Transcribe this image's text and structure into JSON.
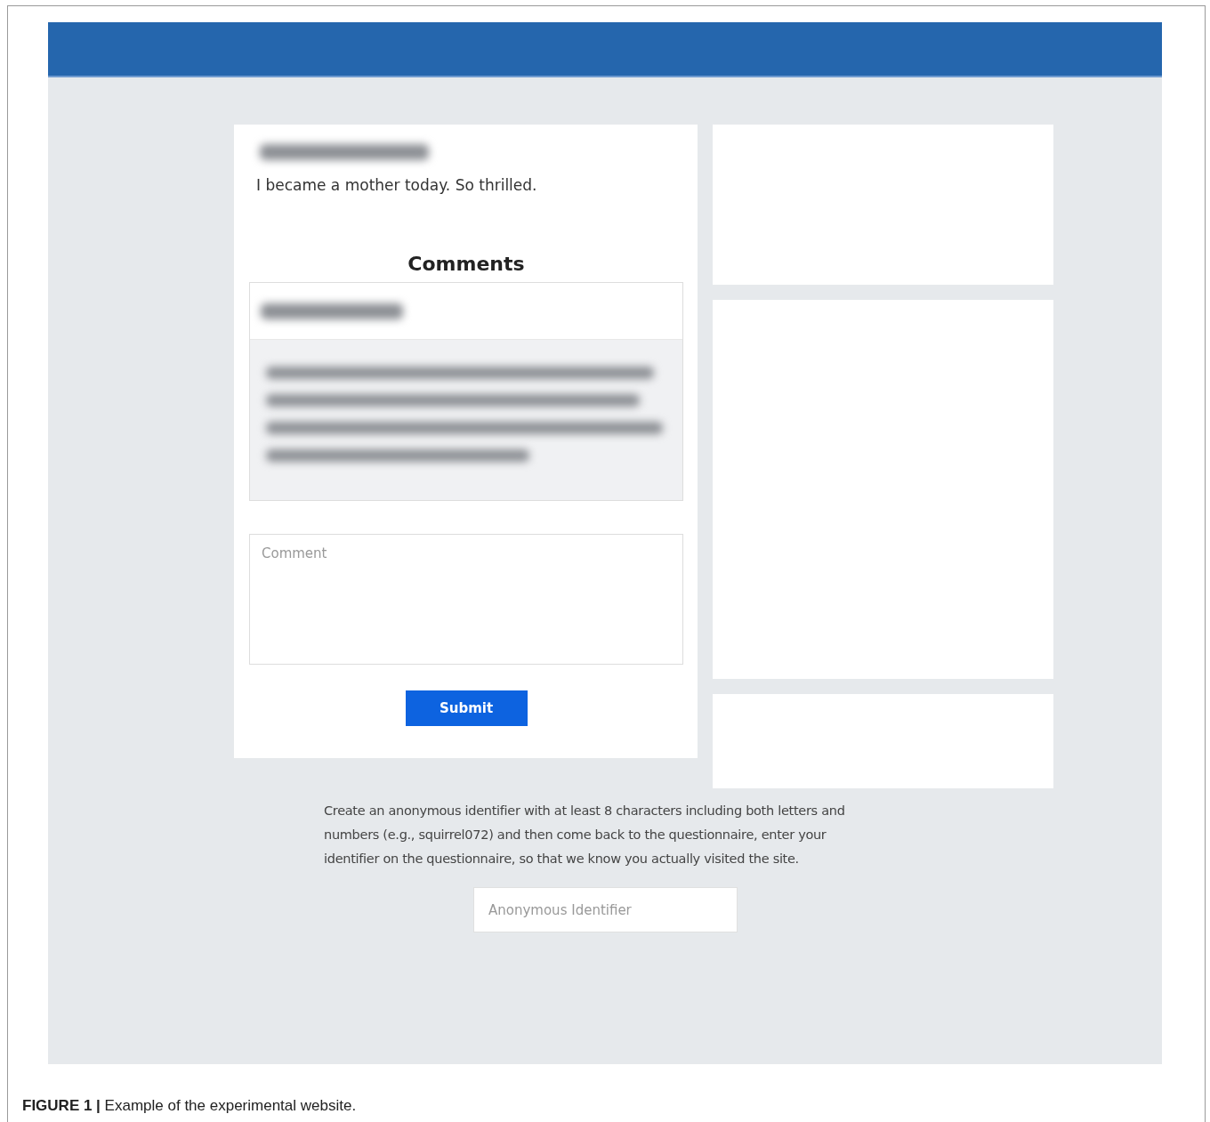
{
  "post": {
    "text": "I became a mother today. So thrilled."
  },
  "comments": {
    "heading": "Comments",
    "comment_field": {
      "placeholder": "Comment"
    },
    "submit_button": "Submit"
  },
  "identifier": {
    "instructions": "Create an anonymous identifier with at least 8 characters including both letters and numbers (e.g., squirrel072) and then come back to the questionnaire, enter your identifier on the questionnaire, so that we know you actually visited the site.",
    "field": {
      "placeholder": "Anonymous Identifier"
    }
  },
  "caption": "**FIGURE 1 |** Example of the experimental website."
}
